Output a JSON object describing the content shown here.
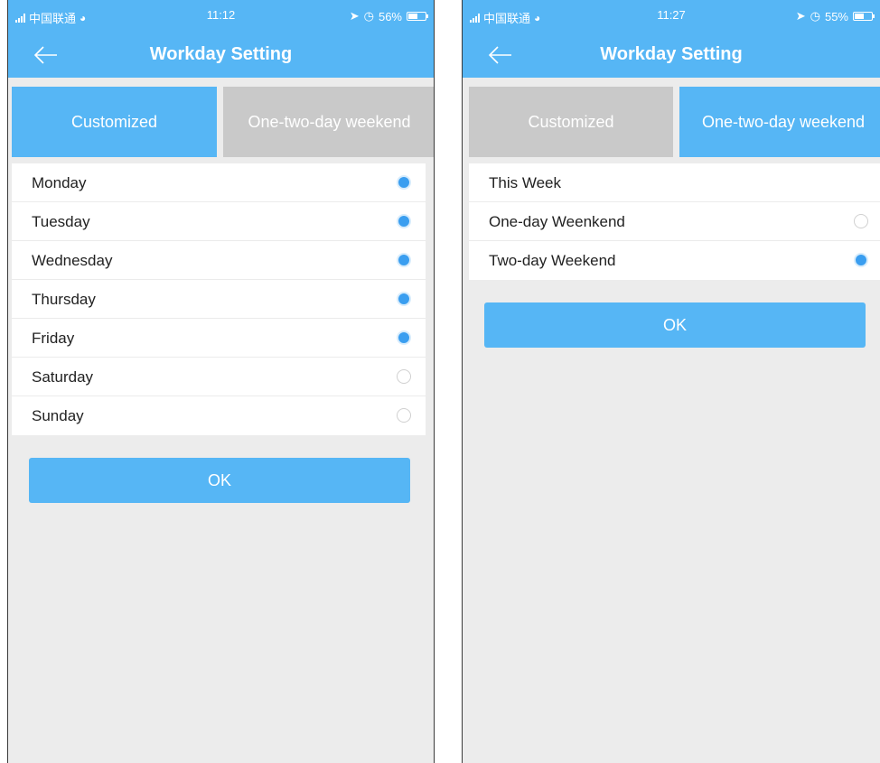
{
  "colors": {
    "accent": "#56b6f5",
    "inactive_tab": "#c9c9c9",
    "background": "#ececec",
    "radio_on": "#3a9ef0"
  },
  "left_screen": {
    "status": {
      "carrier": "中国联通",
      "time": "11:12",
      "battery": "56%",
      "battery_level": 0.56
    },
    "title": "Workday Setting",
    "tabs": [
      {
        "label": "Customized",
        "active": true
      },
      {
        "label": "One-two-day weekend",
        "active": false
      }
    ],
    "days": [
      {
        "label": "Monday",
        "selected": true
      },
      {
        "label": "Tuesday",
        "selected": true
      },
      {
        "label": "Wednesday",
        "selected": true
      },
      {
        "label": "Thursday",
        "selected": true
      },
      {
        "label": "Friday",
        "selected": true
      },
      {
        "label": "Saturday",
        "selected": false
      },
      {
        "label": "Sunday",
        "selected": false
      }
    ],
    "ok_label": "OK"
  },
  "right_screen": {
    "status": {
      "carrier": "中国联通",
      "time": "11:27",
      "battery": "55%",
      "battery_level": 0.55
    },
    "title": "Workday Setting",
    "tabs": [
      {
        "label": "Customized",
        "active": false
      },
      {
        "label": "One-two-day weekend",
        "active": true
      }
    ],
    "options": [
      {
        "label": "This Week",
        "selected": null
      },
      {
        "label": "One-day Weenkend",
        "selected": false
      },
      {
        "label": "Two-day Weekend",
        "selected": true
      }
    ],
    "ok_label": "OK"
  }
}
